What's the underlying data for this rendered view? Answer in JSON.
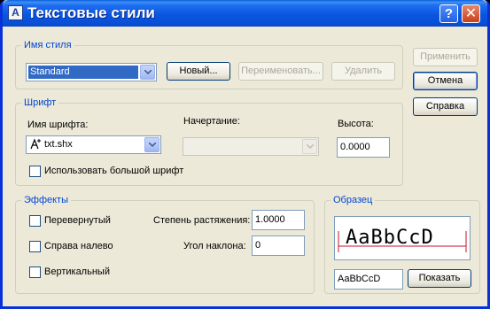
{
  "window": {
    "title": "Текстовые стили",
    "help_glyph": "?",
    "close_glyph": "✕"
  },
  "style_name": {
    "legend": "Имя стиля",
    "selected": "Standard",
    "new_label": "Новый...",
    "rename_label": "Переименовать...",
    "delete_label": "Удалить"
  },
  "side_buttons": {
    "apply_label": "Применить",
    "cancel_label": "Отмена",
    "help_label": "Справка"
  },
  "font": {
    "legend": "Шрифт",
    "name_label": "Имя шрифта:",
    "name_value": "txt.shx",
    "style_label": "Начертание:",
    "style_value": "",
    "height_label": "Высота:",
    "height_value": "0.0000",
    "bigfont_label": "Использовать большой шрифт",
    "bigfont_checked": false
  },
  "effects": {
    "legend": "Эффекты",
    "upside_down_label": "Перевернутый",
    "upside_down_checked": false,
    "backwards_label": "Справа налево",
    "backwards_checked": false,
    "vertical_label": "Вертикальный",
    "vertical_checked": false,
    "width_factor_label": "Степень растяжения:",
    "width_factor_value": "1.0000",
    "oblique_label": "Угол наклона:",
    "oblique_value": "0"
  },
  "preview": {
    "legend": "Образец",
    "preview_text": "AaBbCcD",
    "sample_input": "AaBbCcD",
    "show_label": "Показать"
  },
  "colors": {
    "accent": "#0046d5",
    "titlebar": "#0b55e0",
    "preview_line": "#c8102e"
  }
}
